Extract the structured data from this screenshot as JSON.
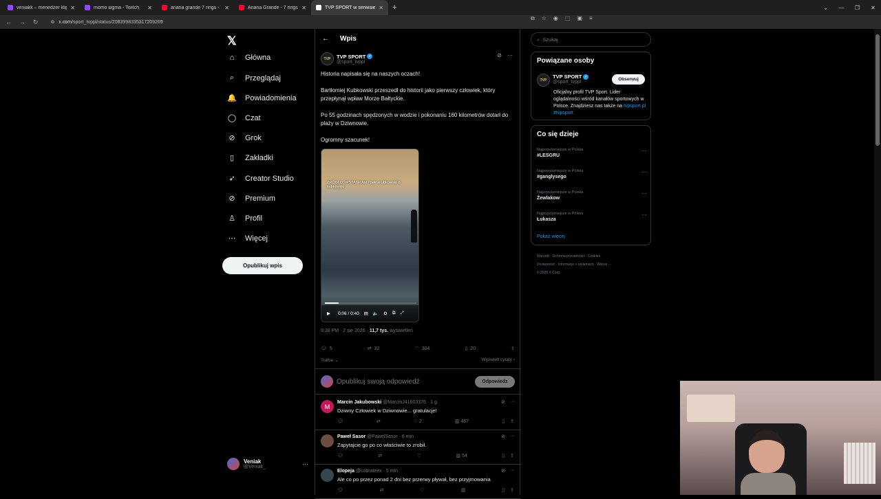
{
  "tabs": [
    {
      "title": "veniakk – menedżer klipów – Tw",
      "color": "#9147ff",
      "active": false
    },
    {
      "title": "momo sigma - Twitch",
      "color": "#9147ff",
      "active": false
    },
    {
      "title": "ariana grande 7 rings - YouTube",
      "color": "#ff0033",
      "active": false
    },
    {
      "title": "Ariana Grande - 7 rings (Officia",
      "color": "#ff0033",
      "active": false
    },
    {
      "title": "TVP SPORT w serwisie X: „Hi",
      "color": "#ffffff",
      "active": true
    }
  ],
  "url": {
    "domain": "x.com",
    "path": "/sport_tvppl/status/2083998335317209269"
  },
  "nav": {
    "items": [
      {
        "label": "Główna",
        "icon": "home-icon",
        "glyph": "⌂"
      },
      {
        "label": "Przeglądaj",
        "icon": "search-icon",
        "glyph": "⌕"
      },
      {
        "label": "Powiadomienia",
        "icon": "bell-icon",
        "glyph": "🔔"
      },
      {
        "label": "Czat",
        "icon": "chat-icon",
        "glyph": "◯"
      },
      {
        "label": "Grok",
        "icon": "grok-icon",
        "glyph": "⊘"
      },
      {
        "label": "Zakładki",
        "icon": "bookmark-icon",
        "glyph": "▯"
      },
      {
        "label": "Creator Studio",
        "icon": "rocket-icon",
        "glyph": "➶"
      },
      {
        "label": "Premium",
        "icon": "premium-icon",
        "glyph": "⊘"
      },
      {
        "label": "Profil",
        "icon": "profile-icon",
        "glyph": "♙"
      },
      {
        "label": "Więcej",
        "icon": "more-icon",
        "glyph": "⋯"
      }
    ],
    "post_button": "Opublikuj wpis",
    "user": {
      "name": "Veniak",
      "handle": "@Veniak_"
    }
  },
  "post": {
    "header_title": "Wpis",
    "author": {
      "name": "TVP SPORT",
      "handle": "@sport_tvppl",
      "avatar_text": "TVP"
    },
    "paragraphs": [
      "Historia napisała się na naszych oczach!",
      "Bartłomiej Kubkowski przeszedł do historii jako pierwszy człowiek, który przepłynął wpław Morze Bałtyckie.",
      "Po 55 godzinach spędzonych w wodzie i pokonaniu 160 kilometrów dotarł do plaży w Dziwnowie.",
      "Ogromny szacunek!"
    ],
    "video": {
      "caption": "ŹRÓDŁO: INSTAGRAM / pełnakubkowski & kubkowski",
      "time": "0:06 / 0:40",
      "progress": 0.15
    },
    "meta": {
      "time": "9:28 PM · 2 sie 2026 · ",
      "views": "11,7 tys.",
      "views_label": " wyświetleń"
    },
    "stats": {
      "replies": "5",
      "reposts": "32",
      "likes": "304",
      "bookmarks": "20"
    },
    "sort_label": "Trafne",
    "quotes_label": "Wyświetl cytaty ›",
    "reply_placeholder": "Opublikuj swoją odpowiedź",
    "reply_button": "Odpowiedz"
  },
  "replies": [
    {
      "name": "Marcin Jakubowski",
      "handle": "@MarcinJ41603376 · 1 g.",
      "text": "Dziwny Człowiek w Dziwnowie... gratulacje!",
      "likes": "2",
      "views": "467",
      "avatar_color": "#c2185b",
      "avatar_letter": "M"
    },
    {
      "name": "Paweł Sasor",
      "handle": "@PawelSasor · 6 min",
      "text": "Zapytajcie go po co właściwie to zrobił.",
      "likes": "",
      "views": "54",
      "avatar_color": "#6d4c41",
      "avatar_letter": ""
    },
    {
      "name": "Elopeja",
      "handle": "@cobrateex · 5 min",
      "text": "Ale co po przez ponad 2 dni bez przerwy pływał, bez przyjmowania",
      "likes": "",
      "views": "",
      "avatar_color": "#37474f",
      "avatar_letter": ""
    }
  ],
  "sidebar": {
    "search_placeholder": "Szukaj",
    "related_title": "Powiązane osoby",
    "related": {
      "name": "TVP SPORT",
      "handle": "@sport_tvppl",
      "follow": "Obserwuj",
      "bio": "Oficjalny profil TVP Sport. Lider oglądalności wśród kanałów sportowych w Polsce. Znajdziesz nas także na ",
      "link1": "tvpsport.pl",
      "link2": "#tvpsport"
    },
    "trends_title": "Co się dzieje",
    "trends": [
      {
        "category": "Najpopularniejsze w Polska",
        "tag": "#LESGRU"
      },
      {
        "category": "Najpopularniejsze w Polska",
        "tag": "#ganglysego"
      },
      {
        "category": "Najpopularniejsze w Polska",
        "tag": "Żewlakow"
      },
      {
        "category": "Najpopularniejsze w Polska",
        "tag": "Łukasza"
      }
    ],
    "show_more": "Pokaż więcej",
    "footer_line1": "Warunki  ·  Ochrona prywatności  ·  Cookies  ·",
    "footer_line2": "Dostępność  ·  Informacje o reklamach  ·  Więcej ···",
    "footer_line3": "© 2026 X Corp."
  }
}
